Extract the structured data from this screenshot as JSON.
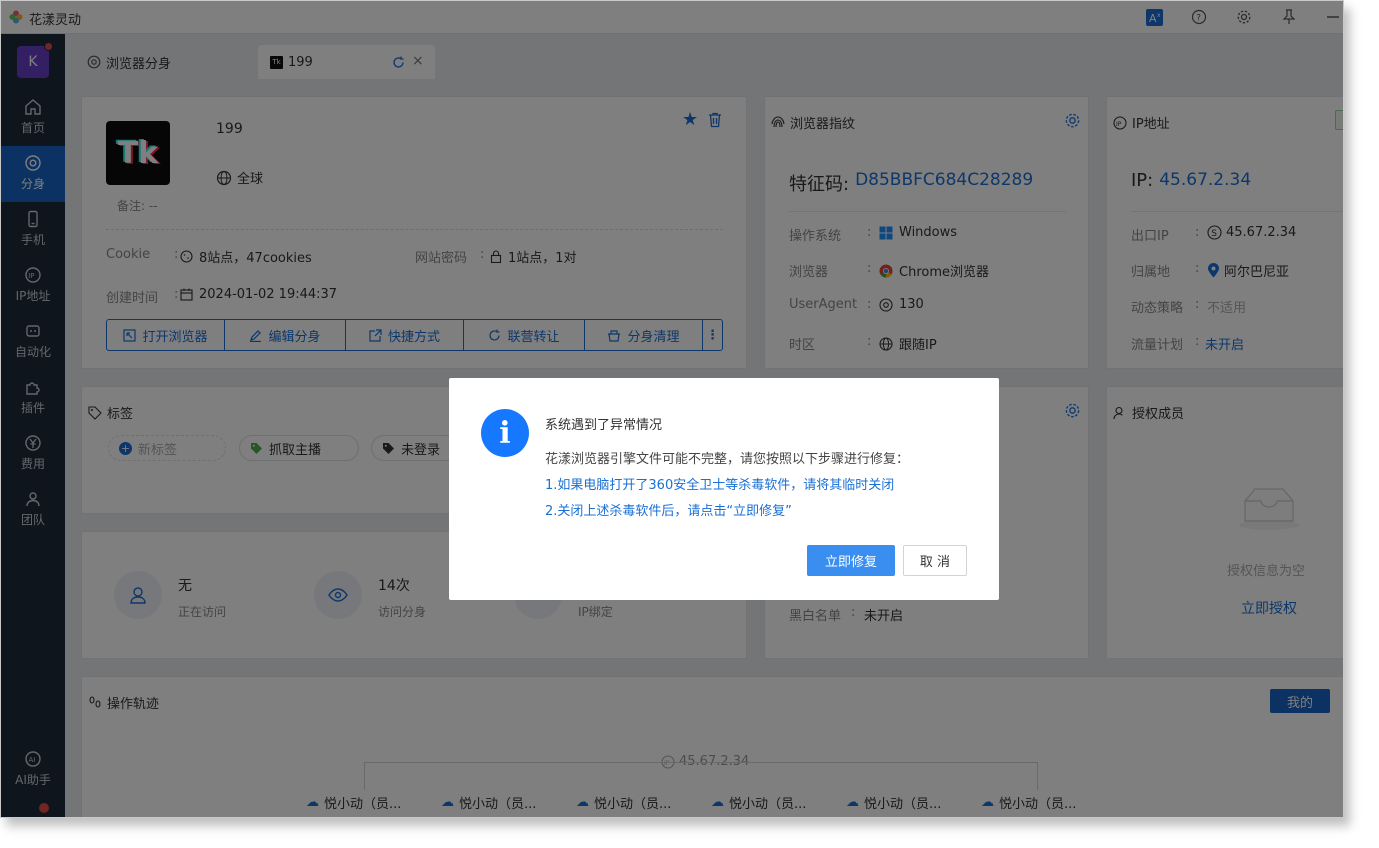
{
  "app": {
    "title": "花漾灵动"
  },
  "sidebar": {
    "avatar_letter": "K",
    "items": [
      {
        "label": "首页",
        "icon": "home-icon"
      },
      {
        "label": "分身",
        "icon": "browser-icon"
      },
      {
        "label": "手机",
        "icon": "phone-icon"
      },
      {
        "label": "IP地址",
        "icon": "ip-icon"
      },
      {
        "label": "自动化",
        "icon": "robot-icon"
      },
      {
        "label": "插件",
        "icon": "puzzle-icon"
      },
      {
        "label": "费用",
        "icon": "yen-icon"
      },
      {
        "label": "团队",
        "icon": "team-icon"
      }
    ],
    "ai_label": "AI助手"
  },
  "tabs": [
    {
      "label": "浏览器分身"
    },
    {
      "label": "199"
    }
  ],
  "profile": {
    "name": "199",
    "region": "全球",
    "remark": "备注: --",
    "cookie_label": "Cookie",
    "cookie_value": "8站点，47cookies",
    "password_label": "网站密码",
    "password_value": "1站点，1对",
    "created_label": "创建时间",
    "created_value": "2024-01-02 19:44:37",
    "actions": [
      "打开浏览器",
      "编辑分身",
      "快捷方式",
      "联营转让",
      "分身清理"
    ]
  },
  "fingerprint": {
    "title": "浏览器指纹",
    "code_label": "特征码:",
    "code_value": "D85BBFC684C28289",
    "os_label": "操作系统",
    "os_value": "Windows",
    "browser_label": "浏览器",
    "browser_value": "Chrome浏览器",
    "ua_label": "UserAgent",
    "ua_value": "130",
    "tz_label": "时区",
    "tz_value": "跟随IP",
    "blacklist_label": "黑白名单",
    "blacklist_value": "未开启"
  },
  "ip": {
    "title": "IP地址",
    "ip_label": "IP:",
    "ip_value": "45.67.2.34",
    "exit_label": "出口IP",
    "exit_value": "45.67.2.34",
    "region_label": "归属地",
    "region_value": "阿尔巴尼亚",
    "policy_label": "动态策略",
    "policy_value": "不适用",
    "traffic_label": "流量计划",
    "traffic_value": "未开启"
  },
  "tags": {
    "title": "标签",
    "new_tag": "新标签",
    "items": [
      "抓取主播",
      "未登录"
    ]
  },
  "stats": [
    {
      "value": "无",
      "label": "正在访问"
    },
    {
      "value": "14次",
      "label": "访问分身"
    },
    {
      "value": "",
      "label": "IP绑定"
    }
  ],
  "members": {
    "title": "授权成员",
    "empty": "授权信息为空",
    "link": "立即授权"
  },
  "track": {
    "title": "操作轨迹",
    "mine_button": "我的",
    "ip_label": "45.67.2.34",
    "nodes": [
      "悦小动（员...",
      "悦小动（员...",
      "悦小动（员...",
      "悦小动（员...",
      "悦小动（员...",
      "悦小动（员..."
    ]
  },
  "dialog": {
    "title": "系统遇到了异常情况",
    "message": "花漾浏览器引擎文件可能不完整，请您按照以下步骤进行修复：",
    "step1": "1.如果电脑打开了360安全卫士等杀毒软件，请将其临时关闭",
    "step2": "2.关闭上述杀毒软件后，请点击“立即修复”",
    "confirm": "立即修复",
    "cancel": "取 消"
  },
  "colors": {
    "primary": "#1a6fd6",
    "sidebar": "#1e2a3a",
    "badge": "#e24a4a"
  }
}
